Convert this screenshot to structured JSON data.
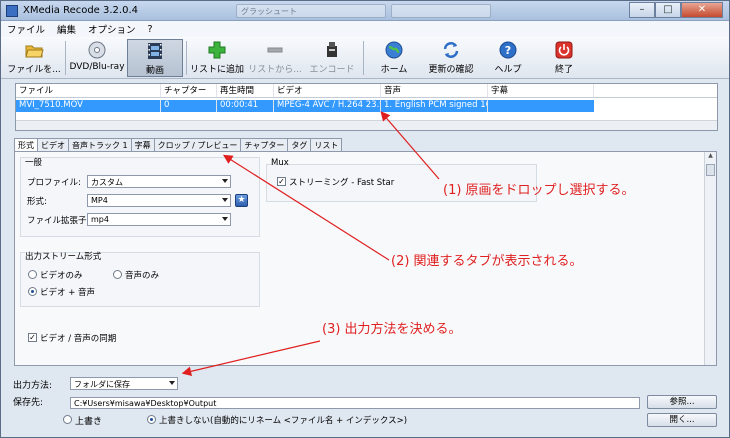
{
  "window": {
    "title": "XMedia Recode 3.2.0.4",
    "ghost_tab": "グラッシュート"
  },
  "menu": {
    "items": [
      "ファイル",
      "編集",
      "オプション",
      "?"
    ]
  },
  "toolbar": {
    "open_file": "ファイルを...",
    "dvd": "DVD/Blu-ray",
    "video": "動画",
    "add_list": "リストに追加",
    "from_list": "リストから...",
    "encode": "エンコード",
    "home": "ホーム",
    "update": "更新の確認",
    "help": "ヘルプ",
    "exit": "終了"
  },
  "file_list": {
    "headers": [
      "ファイル",
      "チャプター",
      "再生時間",
      "ビデオ",
      "音声",
      "字幕"
    ],
    "row": [
      "MVI_7510.MOV",
      "0",
      "00:00:41",
      "MPEG-4 AVC / H.264 23.9...",
      "1. English PCM signed 16-...",
      ""
    ]
  },
  "tabs": [
    "形式",
    "ビデオ",
    "音声トラック 1",
    "字幕",
    "クロップ / プレビュー",
    "チャプター",
    "タグ",
    "リスト"
  ],
  "general": {
    "title": "一般",
    "profile_label": "プロファイル:",
    "profile_value": "カスタム",
    "format_label": "形式:",
    "format_value": "MP4",
    "ext_label": "ファイル拡張子:",
    "ext_value": "mp4"
  },
  "mux": {
    "title": "Mux",
    "streaming_label": "ストリーミング - Fast Star",
    "streaming_checked": true
  },
  "output_stream": {
    "title": "出力ストリーム形式",
    "video_only": "ビデオのみ",
    "audio_only": "音声のみ",
    "video_audio": "ビデオ + 音声",
    "selected": "video_audio"
  },
  "sync": {
    "label": "ビデオ / 音声の同期",
    "checked": true
  },
  "output": {
    "method_label": "出力方法:",
    "method_value": "フォルダに保存",
    "dest_label": "保存先:",
    "dest_value": "C:¥Users¥misawa¥Desktop¥Output",
    "browse": "参照...",
    "open": "開く...",
    "overwrite": "上書き",
    "no_overwrite": "上書きしない(自動的にリネーム <ファイル名 + インデックス>)",
    "overwrite_selected": "no_overwrite"
  },
  "annotations": {
    "step1": "(1) 原画をドロップし選択する。",
    "step2": "(2) 関連するタブが表示される。",
    "step3": "(3) 出力方法を決める。",
    "color": "#e02020"
  }
}
